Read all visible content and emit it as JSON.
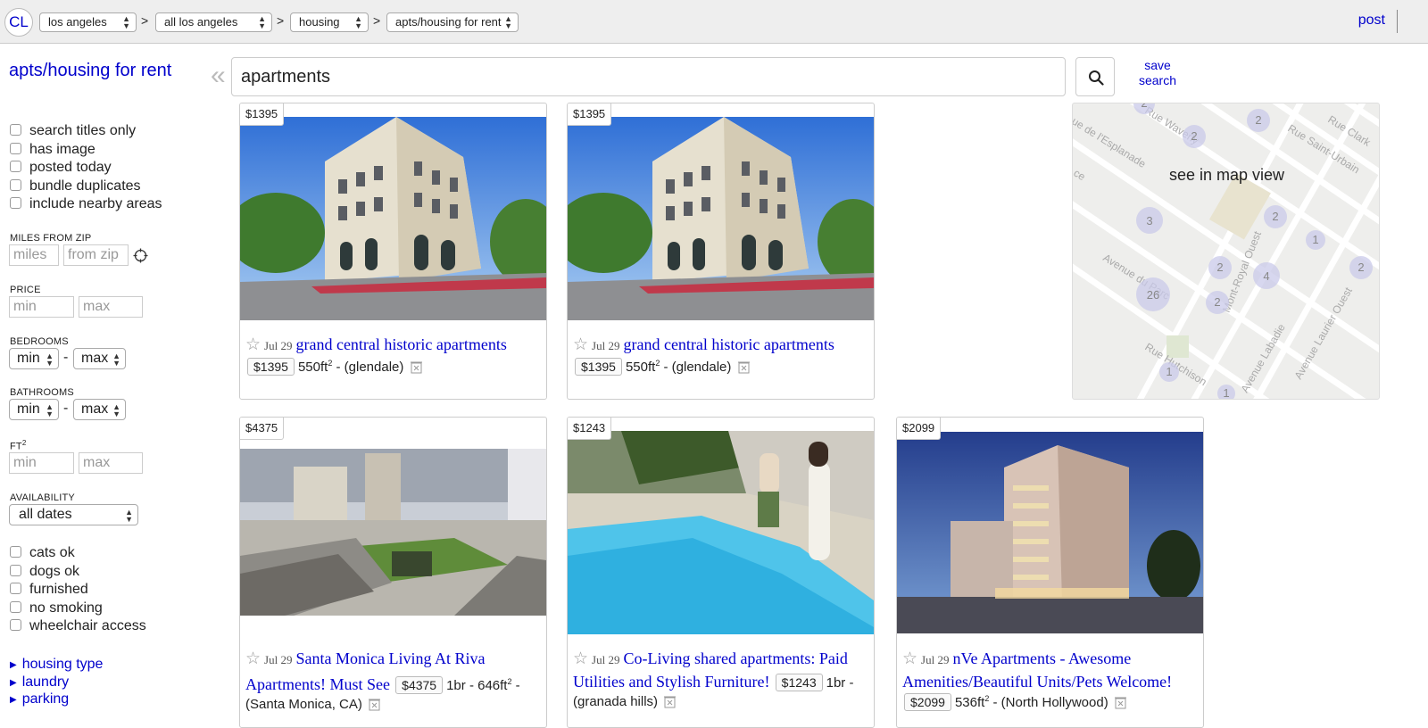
{
  "header": {
    "logo": "CL",
    "breadcrumbs": [
      {
        "label": "los angeles"
      },
      {
        "label": "all los angeles"
      },
      {
        "label": "housing"
      },
      {
        "label": "apts/housing for rent"
      }
    ],
    "separator": ">",
    "post_label": "post"
  },
  "sidebar": {
    "category_title": "apts/housing for rent",
    "checkboxes": [
      {
        "label": "search titles only",
        "checked": false
      },
      {
        "label": "has image",
        "checked": false
      },
      {
        "label": "posted today",
        "checked": false
      },
      {
        "label": "bundle duplicates",
        "checked": false
      },
      {
        "label": "include nearby areas",
        "checked": false
      }
    ],
    "miles_from_zip": {
      "label": "MILES FROM ZIP",
      "miles_placeholder": "miles",
      "zip_placeholder": "from zip"
    },
    "price": {
      "label": "PRICE",
      "min_placeholder": "min",
      "max_placeholder": "max"
    },
    "bedrooms": {
      "label": "BEDROOMS",
      "min": "min",
      "max": "max"
    },
    "bathrooms": {
      "label": "BATHROOMS",
      "min": "min",
      "max": "max"
    },
    "sqft": {
      "label": "FT",
      "label_sup": "2",
      "min_placeholder": "min",
      "max_placeholder": "max"
    },
    "availability": {
      "label": "AVAILABILITY",
      "value": "all dates"
    },
    "dash": "-",
    "pet_checkboxes": [
      {
        "label": "cats ok",
        "checked": false
      },
      {
        "label": "dogs ok",
        "checked": false
      },
      {
        "label": "furnished",
        "checked": false
      },
      {
        "label": "no smoking",
        "checked": false
      },
      {
        "label": "wheelchair access",
        "checked": false
      }
    ],
    "expanders": [
      {
        "label": "housing type"
      },
      {
        "label": "laundry"
      },
      {
        "label": "parking"
      }
    ]
  },
  "search": {
    "query": "apartments",
    "save_label_1": "save",
    "save_label_2": "search"
  },
  "map": {
    "label": "see in map view",
    "streets": [
      "Rue Clark",
      "Rue Saint-Urbain",
      "Rue Waverly",
      "ue de l'Esplanade",
      "ce",
      "Avenue du Parc",
      "Avenue Laurier Ouest",
      "Rue Hutchison",
      "Avenue Labadie",
      "Mont-Royal Ouest"
    ],
    "clusters": [
      "2",
      "2",
      "2",
      "2",
      "3",
      "1",
      "2",
      "4",
      "26",
      "2",
      "2",
      "1",
      "1",
      "2"
    ]
  },
  "results": [
    {
      "price": "$1395",
      "date": "Jul 29",
      "title": "grand central historic apartments",
      "meta_price": "$1395",
      "size": "550ft",
      "size_sup": "2",
      "tail": " - (glendale)",
      "housing_info": "",
      "location_line": ""
    },
    {
      "price": "$1395",
      "date": "Jul 29",
      "title": "grand central historic apartments",
      "meta_price": "$1395",
      "size": "550ft",
      "size_sup": "2",
      "tail": " - (glendale)",
      "housing_info": "",
      "location_line": ""
    },
    {
      "price": "$4375",
      "date": "Jul 29",
      "title": "Santa Monica Living At Riva Apartments! Must See",
      "meta_price": "$4375",
      "size": "1br - 646ft",
      "size_sup": "2",
      "tail": " -",
      "location_line": "(Santa Monica, CA)"
    },
    {
      "price": "$1243",
      "date": "Jul 29",
      "title": "Co-Living shared apartments: Paid Utilities and Stylish Furniture!",
      "meta_price": "$1243",
      "size": "1br -",
      "size_sup": "",
      "tail": "",
      "location_line": "(granada hills)"
    },
    {
      "price": "$2099",
      "date": "Jul 29",
      "title": "nVe Apartments - Awesome Amenities/Beautiful Units/Pets Welcome!",
      "meta_price": "$2099",
      "size": "536ft",
      "size_sup": "2",
      "tail": " - (North Hollywood)",
      "location_line": ""
    }
  ],
  "colors": {
    "link": "#0000cc",
    "header_bg": "#eeeeee",
    "border": "#cccccc"
  }
}
